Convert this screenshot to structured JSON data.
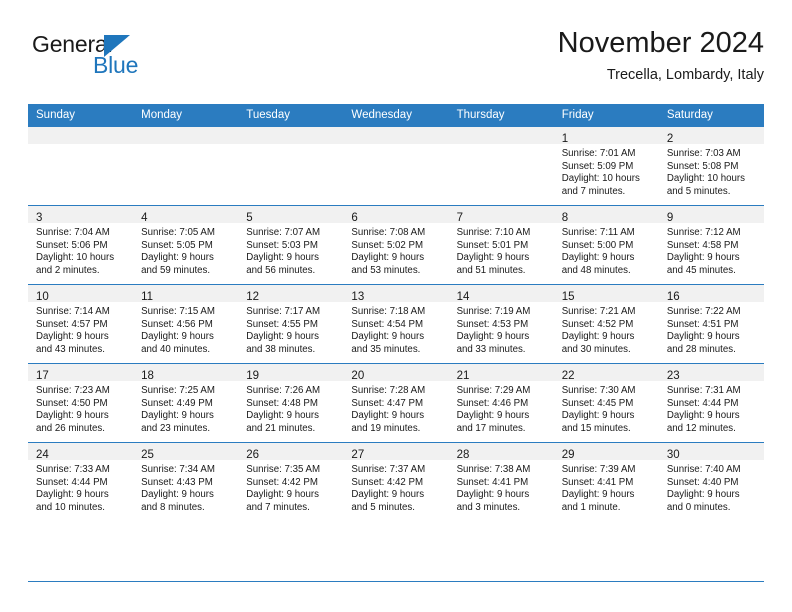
{
  "brand": {
    "name_part1": "General",
    "name_part2": "Blue",
    "color_blue": "#1f76bc",
    "triangle_icon": "triangle-icon"
  },
  "header": {
    "title": "November 2024",
    "subtitle": "Trecella, Lombardy, Italy"
  },
  "theme": {
    "header_bg": "#2b7cc0",
    "daynum_bg": "#f1f1f1",
    "grid_line": "#2b7cc0",
    "text": "#1a1a1a"
  },
  "weekdays": [
    "Sunday",
    "Monday",
    "Tuesday",
    "Wednesday",
    "Thursday",
    "Friday",
    "Saturday"
  ],
  "weeks": [
    [
      {
        "day": "",
        "empty": true,
        "l1": "",
        "l2": "",
        "l3": "",
        "l4": ""
      },
      {
        "day": "",
        "empty": true,
        "l1": "",
        "l2": "",
        "l3": "",
        "l4": ""
      },
      {
        "day": "",
        "empty": true,
        "l1": "",
        "l2": "",
        "l3": "",
        "l4": ""
      },
      {
        "day": "",
        "empty": true,
        "l1": "",
        "l2": "",
        "l3": "",
        "l4": ""
      },
      {
        "day": "",
        "empty": true,
        "l1": "",
        "l2": "",
        "l3": "",
        "l4": ""
      },
      {
        "day": "1",
        "empty": false,
        "l1": "Sunrise: 7:01 AM",
        "l2": "Sunset: 5:09 PM",
        "l3": "Daylight: 10 hours",
        "l4": "and 7 minutes."
      },
      {
        "day": "2",
        "empty": false,
        "l1": "Sunrise: 7:03 AM",
        "l2": "Sunset: 5:08 PM",
        "l3": "Daylight: 10 hours",
        "l4": "and 5 minutes."
      }
    ],
    [
      {
        "day": "3",
        "empty": false,
        "l1": "Sunrise: 7:04 AM",
        "l2": "Sunset: 5:06 PM",
        "l3": "Daylight: 10 hours",
        "l4": "and 2 minutes."
      },
      {
        "day": "4",
        "empty": false,
        "l1": "Sunrise: 7:05 AM",
        "l2": "Sunset: 5:05 PM",
        "l3": "Daylight: 9 hours",
        "l4": "and 59 minutes."
      },
      {
        "day": "5",
        "empty": false,
        "l1": "Sunrise: 7:07 AM",
        "l2": "Sunset: 5:03 PM",
        "l3": "Daylight: 9 hours",
        "l4": "and 56 minutes."
      },
      {
        "day": "6",
        "empty": false,
        "l1": "Sunrise: 7:08 AM",
        "l2": "Sunset: 5:02 PM",
        "l3": "Daylight: 9 hours",
        "l4": "and 53 minutes."
      },
      {
        "day": "7",
        "empty": false,
        "l1": "Sunrise: 7:10 AM",
        "l2": "Sunset: 5:01 PM",
        "l3": "Daylight: 9 hours",
        "l4": "and 51 minutes."
      },
      {
        "day": "8",
        "empty": false,
        "l1": "Sunrise: 7:11 AM",
        "l2": "Sunset: 5:00 PM",
        "l3": "Daylight: 9 hours",
        "l4": "and 48 minutes."
      },
      {
        "day": "9",
        "empty": false,
        "l1": "Sunrise: 7:12 AM",
        "l2": "Sunset: 4:58 PM",
        "l3": "Daylight: 9 hours",
        "l4": "and 45 minutes."
      }
    ],
    [
      {
        "day": "10",
        "empty": false,
        "l1": "Sunrise: 7:14 AM",
        "l2": "Sunset: 4:57 PM",
        "l3": "Daylight: 9 hours",
        "l4": "and 43 minutes."
      },
      {
        "day": "11",
        "empty": false,
        "l1": "Sunrise: 7:15 AM",
        "l2": "Sunset: 4:56 PM",
        "l3": "Daylight: 9 hours",
        "l4": "and 40 minutes."
      },
      {
        "day": "12",
        "empty": false,
        "l1": "Sunrise: 7:17 AM",
        "l2": "Sunset: 4:55 PM",
        "l3": "Daylight: 9 hours",
        "l4": "and 38 minutes."
      },
      {
        "day": "13",
        "empty": false,
        "l1": "Sunrise: 7:18 AM",
        "l2": "Sunset: 4:54 PM",
        "l3": "Daylight: 9 hours",
        "l4": "and 35 minutes."
      },
      {
        "day": "14",
        "empty": false,
        "l1": "Sunrise: 7:19 AM",
        "l2": "Sunset: 4:53 PM",
        "l3": "Daylight: 9 hours",
        "l4": "and 33 minutes."
      },
      {
        "day": "15",
        "empty": false,
        "l1": "Sunrise: 7:21 AM",
        "l2": "Sunset: 4:52 PM",
        "l3": "Daylight: 9 hours",
        "l4": "and 30 minutes."
      },
      {
        "day": "16",
        "empty": false,
        "l1": "Sunrise: 7:22 AM",
        "l2": "Sunset: 4:51 PM",
        "l3": "Daylight: 9 hours",
        "l4": "and 28 minutes."
      }
    ],
    [
      {
        "day": "17",
        "empty": false,
        "l1": "Sunrise: 7:23 AM",
        "l2": "Sunset: 4:50 PM",
        "l3": "Daylight: 9 hours",
        "l4": "and 26 minutes."
      },
      {
        "day": "18",
        "empty": false,
        "l1": "Sunrise: 7:25 AM",
        "l2": "Sunset: 4:49 PM",
        "l3": "Daylight: 9 hours",
        "l4": "and 23 minutes."
      },
      {
        "day": "19",
        "empty": false,
        "l1": "Sunrise: 7:26 AM",
        "l2": "Sunset: 4:48 PM",
        "l3": "Daylight: 9 hours",
        "l4": "and 21 minutes."
      },
      {
        "day": "20",
        "empty": false,
        "l1": "Sunrise: 7:28 AM",
        "l2": "Sunset: 4:47 PM",
        "l3": "Daylight: 9 hours",
        "l4": "and 19 minutes."
      },
      {
        "day": "21",
        "empty": false,
        "l1": "Sunrise: 7:29 AM",
        "l2": "Sunset: 4:46 PM",
        "l3": "Daylight: 9 hours",
        "l4": "and 17 minutes."
      },
      {
        "day": "22",
        "empty": false,
        "l1": "Sunrise: 7:30 AM",
        "l2": "Sunset: 4:45 PM",
        "l3": "Daylight: 9 hours",
        "l4": "and 15 minutes."
      },
      {
        "day": "23",
        "empty": false,
        "l1": "Sunrise: 7:31 AM",
        "l2": "Sunset: 4:44 PM",
        "l3": "Daylight: 9 hours",
        "l4": "and 12 minutes."
      }
    ],
    [
      {
        "day": "24",
        "empty": false,
        "l1": "Sunrise: 7:33 AM",
        "l2": "Sunset: 4:44 PM",
        "l3": "Daylight: 9 hours",
        "l4": "and 10 minutes."
      },
      {
        "day": "25",
        "empty": false,
        "l1": "Sunrise: 7:34 AM",
        "l2": "Sunset: 4:43 PM",
        "l3": "Daylight: 9 hours",
        "l4": "and 8 minutes."
      },
      {
        "day": "26",
        "empty": false,
        "l1": "Sunrise: 7:35 AM",
        "l2": "Sunset: 4:42 PM",
        "l3": "Daylight: 9 hours",
        "l4": "and 7 minutes."
      },
      {
        "day": "27",
        "empty": false,
        "l1": "Sunrise: 7:37 AM",
        "l2": "Sunset: 4:42 PM",
        "l3": "Daylight: 9 hours",
        "l4": "and 5 minutes."
      },
      {
        "day": "28",
        "empty": false,
        "l1": "Sunrise: 7:38 AM",
        "l2": "Sunset: 4:41 PM",
        "l3": "Daylight: 9 hours",
        "l4": "and 3 minutes."
      },
      {
        "day": "29",
        "empty": false,
        "l1": "Sunrise: 7:39 AM",
        "l2": "Sunset: 4:41 PM",
        "l3": "Daylight: 9 hours",
        "l4": "and 1 minute."
      },
      {
        "day": "30",
        "empty": false,
        "l1": "Sunrise: 7:40 AM",
        "l2": "Sunset: 4:40 PM",
        "l3": "Daylight: 9 hours",
        "l4": "and 0 minutes."
      }
    ]
  ]
}
